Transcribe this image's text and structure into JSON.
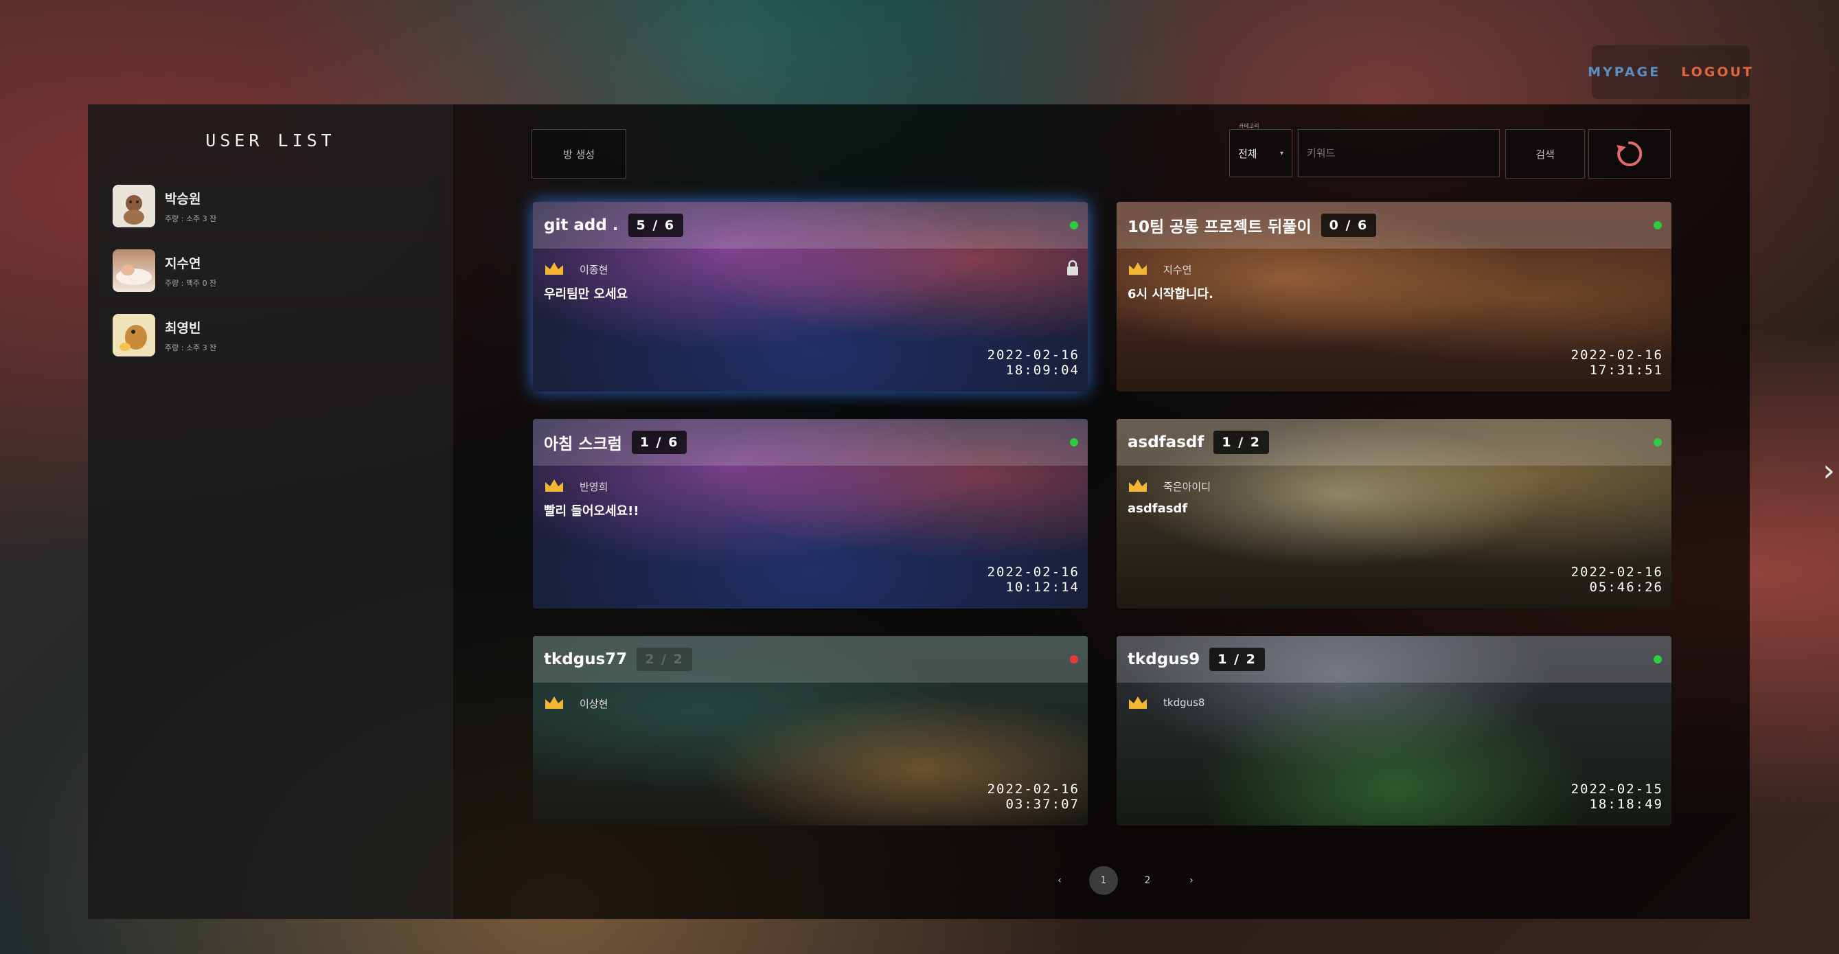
{
  "topnav": {
    "mypage": "MYPAGE",
    "logout": "LOGOUT"
  },
  "sidebar": {
    "title": "USER LIST",
    "users": [
      {
        "name": "박승원",
        "sub": "주량 : 소주 3 잔"
      },
      {
        "name": "지수연",
        "sub": "주량 : 맥주 0 잔"
      },
      {
        "name": "최영빈",
        "sub": "주량 : 소주 3 잔"
      }
    ]
  },
  "toolbar": {
    "create_room": "방 생성",
    "category_caption": "카테고리",
    "category_value": "전체",
    "keyword_placeholder": "키워드",
    "search": "검색"
  },
  "rooms": [
    {
      "title": "git add .",
      "count": "5 / 6",
      "host": "이종현",
      "desc": "우리팀만 오세요",
      "date": "2022-02-16",
      "time": "18:09:04",
      "status_color": "#2ecc40",
      "locked": true
    },
    {
      "title": "10팀 공통 프로젝트 뒤풀이",
      "count": "0 / 6",
      "host": "지수연",
      "desc": "6시 시작합니다.",
      "date": "2022-02-16",
      "time": "17:31:51",
      "status_color": "#2ecc40",
      "locked": false
    },
    {
      "title": "아침 스크럼",
      "count": "1 / 6",
      "host": "반영희",
      "desc": "빨리 들어오세요!!",
      "date": "2022-02-16",
      "time": "10:12:14",
      "status_color": "#2ecc40",
      "locked": false
    },
    {
      "title": "asdfasdf",
      "count": "1 / 2",
      "host": "죽은아이디",
      "desc": "asdfasdf",
      "date": "2022-02-16",
      "time": "05:46:26",
      "status_color": "#2ecc40",
      "locked": false
    },
    {
      "title": "tkdgus77",
      "count": "2 / 2",
      "host": "이상현",
      "desc": "",
      "date": "2022-02-16",
      "time": "03:37:07",
      "status_color": "#e53935",
      "locked": false
    },
    {
      "title": "tkdgus9",
      "count": "1 / 2",
      "host": "tkdgus8",
      "desc": "",
      "date": "2022-02-15",
      "time": "18:18:49",
      "status_color": "#2ecc40",
      "locked": false
    }
  ],
  "pagination": {
    "prev": "‹",
    "pages": [
      "1",
      "2"
    ],
    "current": "1",
    "next": "›"
  },
  "side_arrow": "›"
}
